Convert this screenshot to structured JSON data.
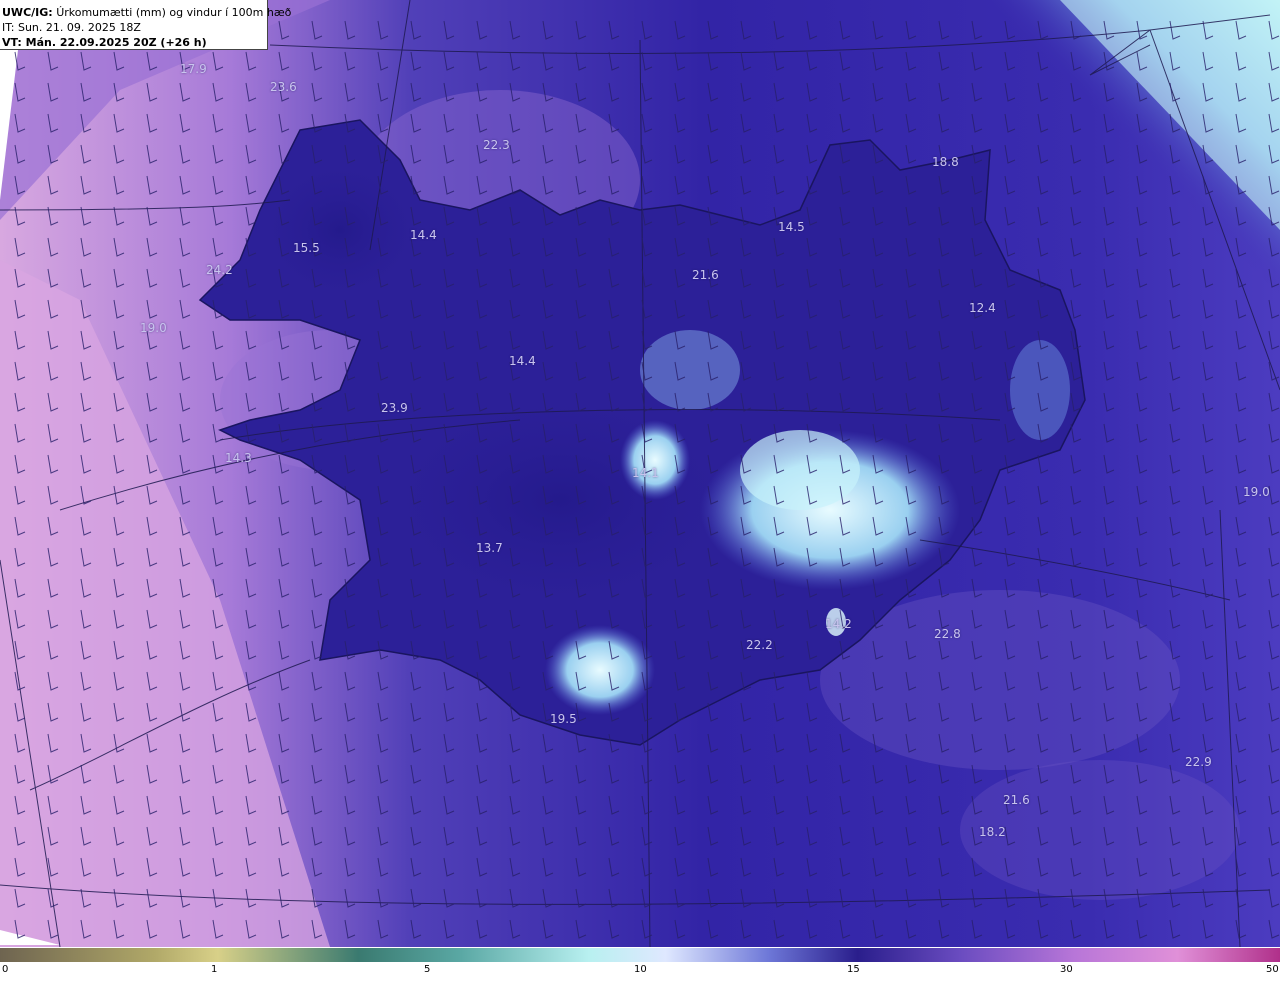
{
  "header": {
    "model": "UWC/IG:",
    "title": "Úrkomumætti (mm) og vindur í 100m hæð",
    "it_label": "IT:",
    "it_value": "Sun. 21. 09. 2025 18Z",
    "vt_label": "VT:",
    "vt_value": "Mán. 22.09.2025 20Z (+26 h)"
  },
  "map_values": [
    {
      "text": "17.9"
    },
    {
      "text": "23.6"
    },
    {
      "text": "22.3"
    },
    {
      "text": "18.8"
    },
    {
      "text": "14.4"
    },
    {
      "text": "15.5"
    },
    {
      "text": "14.5"
    },
    {
      "text": "24.2"
    },
    {
      "text": "21.6"
    },
    {
      "text": "19.0"
    },
    {
      "text": "12.4"
    },
    {
      "text": "14.4"
    },
    {
      "text": "23.9"
    },
    {
      "text": "14.3"
    },
    {
      "text": "14.1"
    },
    {
      "text": "19.0"
    },
    {
      "text": "13.7"
    },
    {
      "text": "22.2"
    },
    {
      "text": "14.2"
    },
    {
      "text": "22.8"
    },
    {
      "text": "19.5"
    },
    {
      "text": "22.9"
    },
    {
      "text": "21.6"
    },
    {
      "text": "18.2"
    }
  ],
  "colorbar": {
    "ticks": [
      "0",
      "1",
      "5",
      "10",
      "15",
      "30",
      "50"
    ],
    "colors": [
      "#6e6450",
      "#b0a868",
      "#d8d088",
      "#3a7a70",
      "#5aa8a4",
      "#b8f0f0",
      "#dfe8ff",
      "#6e78d8",
      "#2a1e8c",
      "#6a4cc0",
      "#b876d8",
      "#e090d8",
      "#b0308a"
    ]
  }
}
